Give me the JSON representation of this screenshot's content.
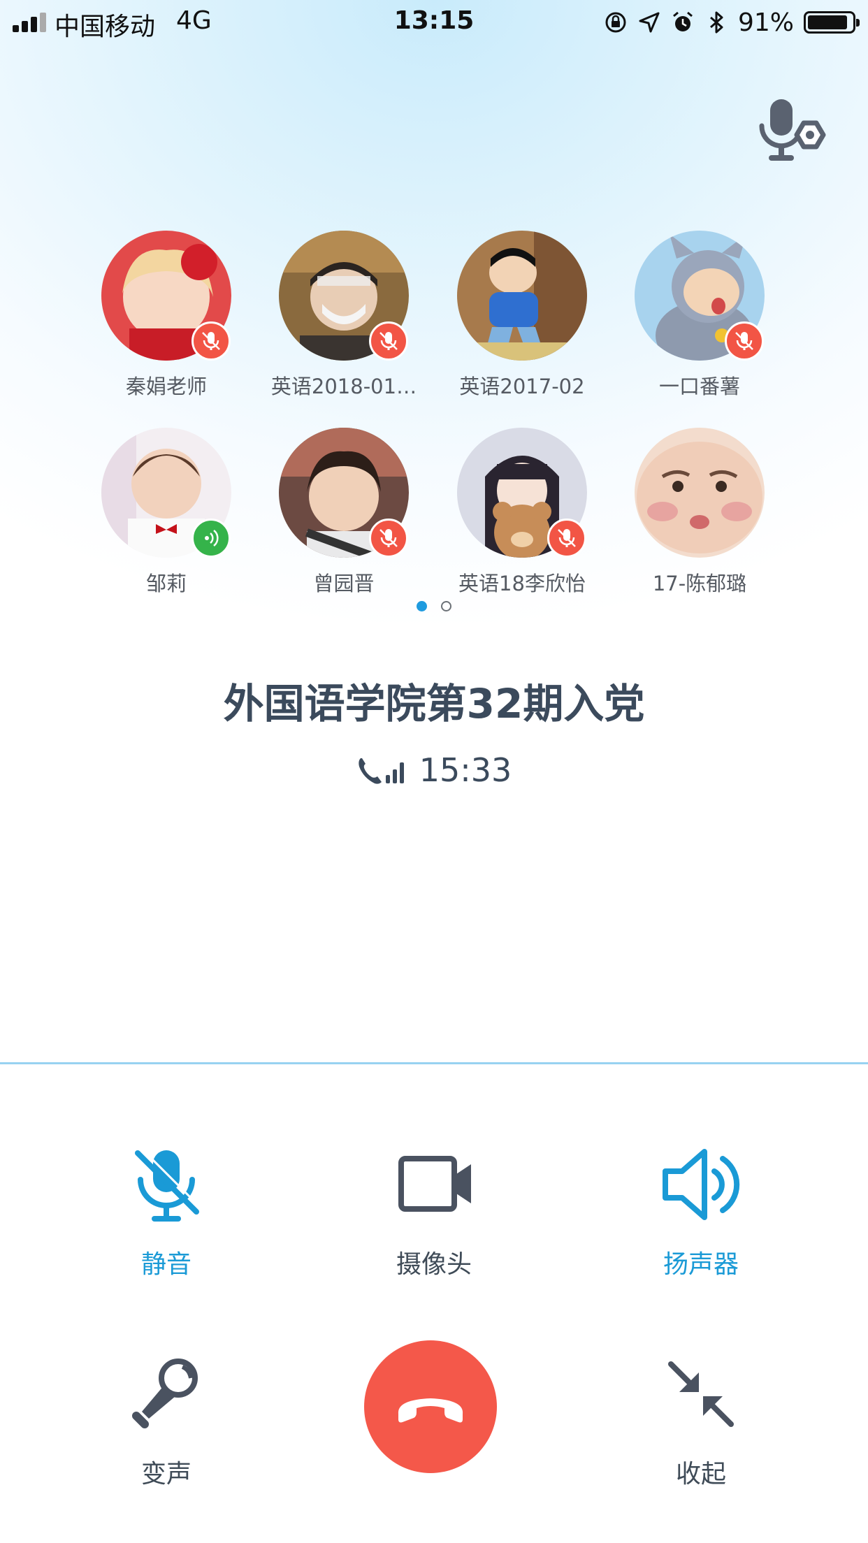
{
  "status_bar": {
    "carrier": "中国移动",
    "network": "4G",
    "time": "13:15",
    "battery_percent": "91%",
    "battery_level": 0.91,
    "icons": [
      "orientation-lock-icon",
      "location-icon",
      "alarm-icon",
      "bluetooth-icon"
    ]
  },
  "header": {
    "voice_settings_icon": "voice-settings-icon"
  },
  "participants": [
    {
      "name": "秦娟老师",
      "status": "muted"
    },
    {
      "name": "英语2018-01…",
      "status": "muted"
    },
    {
      "name": "英语2017-02",
      "status": "none"
    },
    {
      "name": "一口番薯",
      "status": "muted"
    },
    {
      "name": "邹莉",
      "status": "speaking"
    },
    {
      "name": "曾园晋",
      "status": "muted"
    },
    {
      "name": "英语18李欣怡",
      "status": "muted"
    },
    {
      "name": "17-陈郁璐",
      "status": "none"
    }
  ],
  "pager": {
    "current": 1,
    "total": 2
  },
  "call": {
    "title": "外国语学院第32期入党",
    "duration": "15:33"
  },
  "controls": {
    "mute": {
      "label": "静音",
      "active": true
    },
    "camera": {
      "label": "摄像头",
      "active": false
    },
    "speaker": {
      "label": "扬声器",
      "active": true
    },
    "voice_changer": {
      "label": "变声"
    },
    "minimize": {
      "label": "收起"
    }
  },
  "colors": {
    "accent": "#1a9ad6",
    "muted_badge": "#f25545",
    "speaking_badge": "#35b34a",
    "hangup": "#f4584a",
    "title": "#3b4a5c",
    "icon_gray": "#4a5260"
  }
}
